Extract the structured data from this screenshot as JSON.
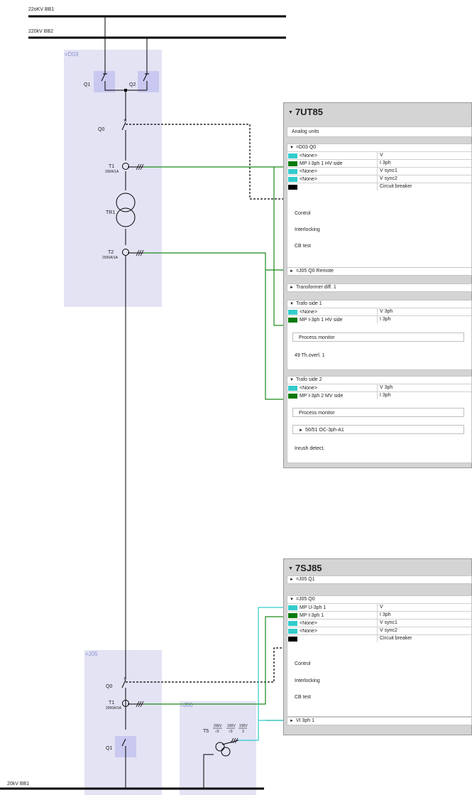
{
  "busbars": {
    "bb1_top": "22oKV BB1",
    "bb2_top": "220kV BB2",
    "bb1_bottom": "20kV BB1"
  },
  "bays": {
    "d03": "=D03",
    "j05": "=J05",
    "j00": "=J00"
  },
  "d03_labels": {
    "q1": "Q1",
    "q2": "Q2",
    "q0": "Q0",
    "t1": "T1",
    "t1_rating": "200A/1A",
    "tr1": "TR1",
    "t2": "T2",
    "t2_rating": "2000A/1A"
  },
  "j05_labels": {
    "q0": "Q0",
    "t1": "T1",
    "t1_rating": "2000A/1A",
    "q1": "Q1",
    "t5": "T5"
  },
  "t5_ratio": {
    "a_num": "20kV",
    "a_den": "√3",
    "b_num": "100V",
    "b_den": "√3",
    "c_num": "100V",
    "c_den": "3"
  },
  "device_7ut85": {
    "title": "7UT85",
    "analog": "Analog units",
    "d03q0": {
      "header": "=D03 Q0",
      "rows": [
        {
          "name": "<None>",
          "type": "V",
          "color": "#33cccc"
        },
        {
          "name": "MP I-3ph 1 HV side",
          "type": "I 3ph",
          "color": "#0a7a0a"
        },
        {
          "name": "<None>",
          "type": "V sync1",
          "color": "#33cccc"
        },
        {
          "name": "<None>",
          "type": "V sync2",
          "color": "#33cccc"
        },
        {
          "name": "",
          "type": "Circuit breaker",
          "color": "#000000"
        }
      ],
      "control": "Control",
      "interlocking": "Interlocking",
      "cbtest": "CB test"
    },
    "j05remote": "=J05 Q0 Remote",
    "trafodiff": "Transformer diff. 1",
    "side1": {
      "header": "Trafo side 1",
      "rows": [
        {
          "name": "<None>",
          "type": "V 3ph",
          "color": "#33cccc"
        },
        {
          "name": "MP I-3ph 1 HV side",
          "type": "I 3ph",
          "color": "#0a7a0a"
        }
      ],
      "process": "Process monitor",
      "overload": "49 Th.overl. 1"
    },
    "side2": {
      "header": "Trafo side 2",
      "rows": [
        {
          "name": "<None>",
          "type": "V 3ph",
          "color": "#33cccc"
        },
        {
          "name": "MP I-3ph 2 MV side",
          "type": "I 3ph",
          "color": "#0a7a0a"
        }
      ],
      "process": "Process monitor",
      "oc": "50/51 OC-3ph-A1",
      "inrush": "Inrush detect."
    }
  },
  "device_7sj85": {
    "title": "7SJ85",
    "j05q1": "=J05 Q1",
    "j05q0": {
      "header": "=J05 Q0",
      "rows": [
        {
          "name": "MP U-3ph 1",
          "type": "V",
          "color": "#33cccc"
        },
        {
          "name": "MP I-3ph 1",
          "type": "I 3ph",
          "color": "#0a7a0a"
        },
        {
          "name": "<None>",
          "type": "V sync1",
          "color": "#33cccc"
        },
        {
          "name": "<None>",
          "type": "V sync2",
          "color": "#33cccc"
        },
        {
          "name": "",
          "type": "Circuit breaker",
          "color": "#000000"
        }
      ],
      "control": "Control",
      "interlocking": "Interlocking",
      "cbtest": "CB test"
    },
    "vi3ph": "VI 3ph 1"
  },
  "colors": {
    "bay": "#e3e3f4",
    "switch_hl": "#c8c8f0",
    "wire_green": "#1a8a1a",
    "wire_cyan": "#33cccc",
    "panel": "#d4d4d4"
  }
}
